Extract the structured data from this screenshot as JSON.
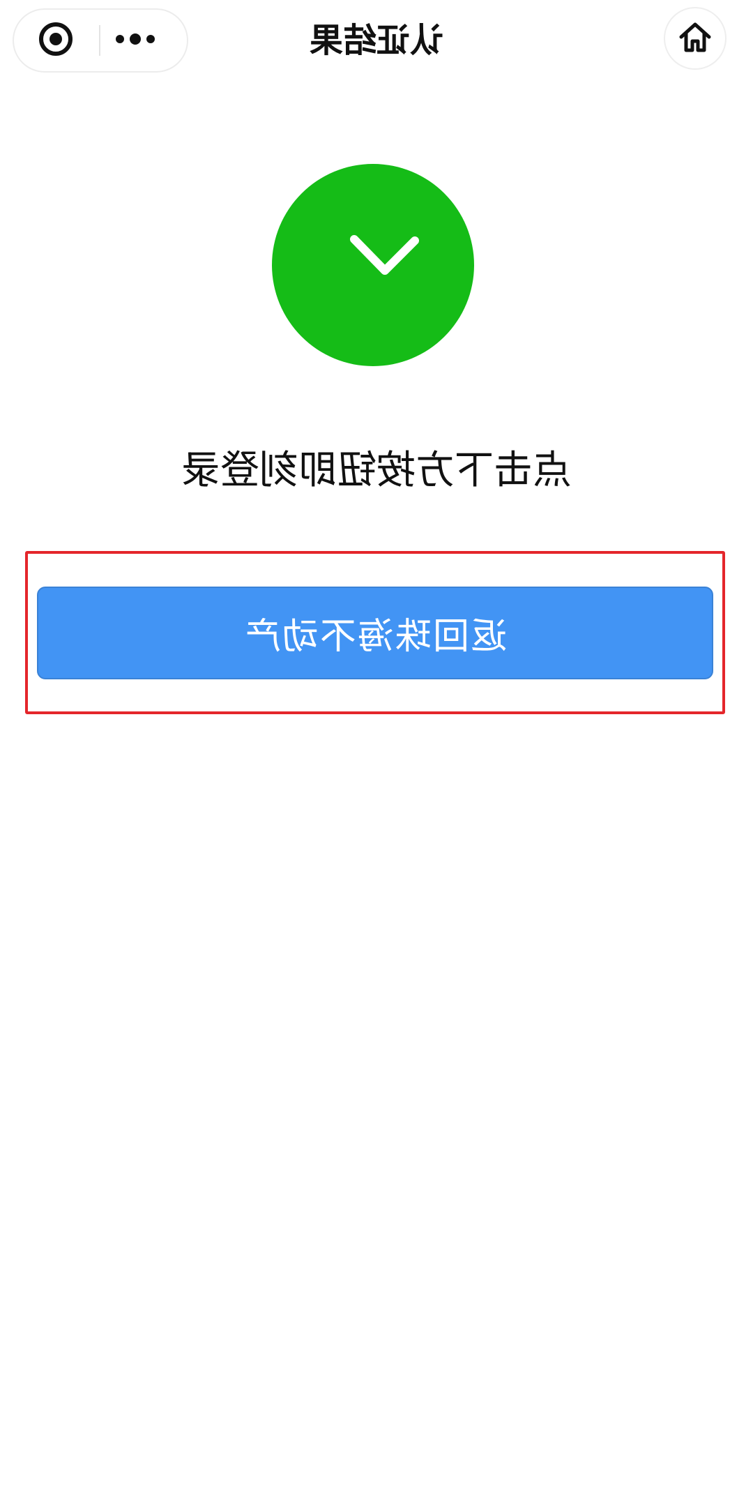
{
  "header": {
    "title": "认证结果",
    "home_icon": "home-icon",
    "more_icon": "more-dots-icon",
    "close_icon": "target-close-icon"
  },
  "result": {
    "status_icon": "success-check-icon",
    "status_color": "#15bc17",
    "message": "点击下方按钮即刻登录"
  },
  "action": {
    "button_label": "返回珠海不动产",
    "button_color": "#4294f4",
    "highlight_color": "#e4262b"
  }
}
